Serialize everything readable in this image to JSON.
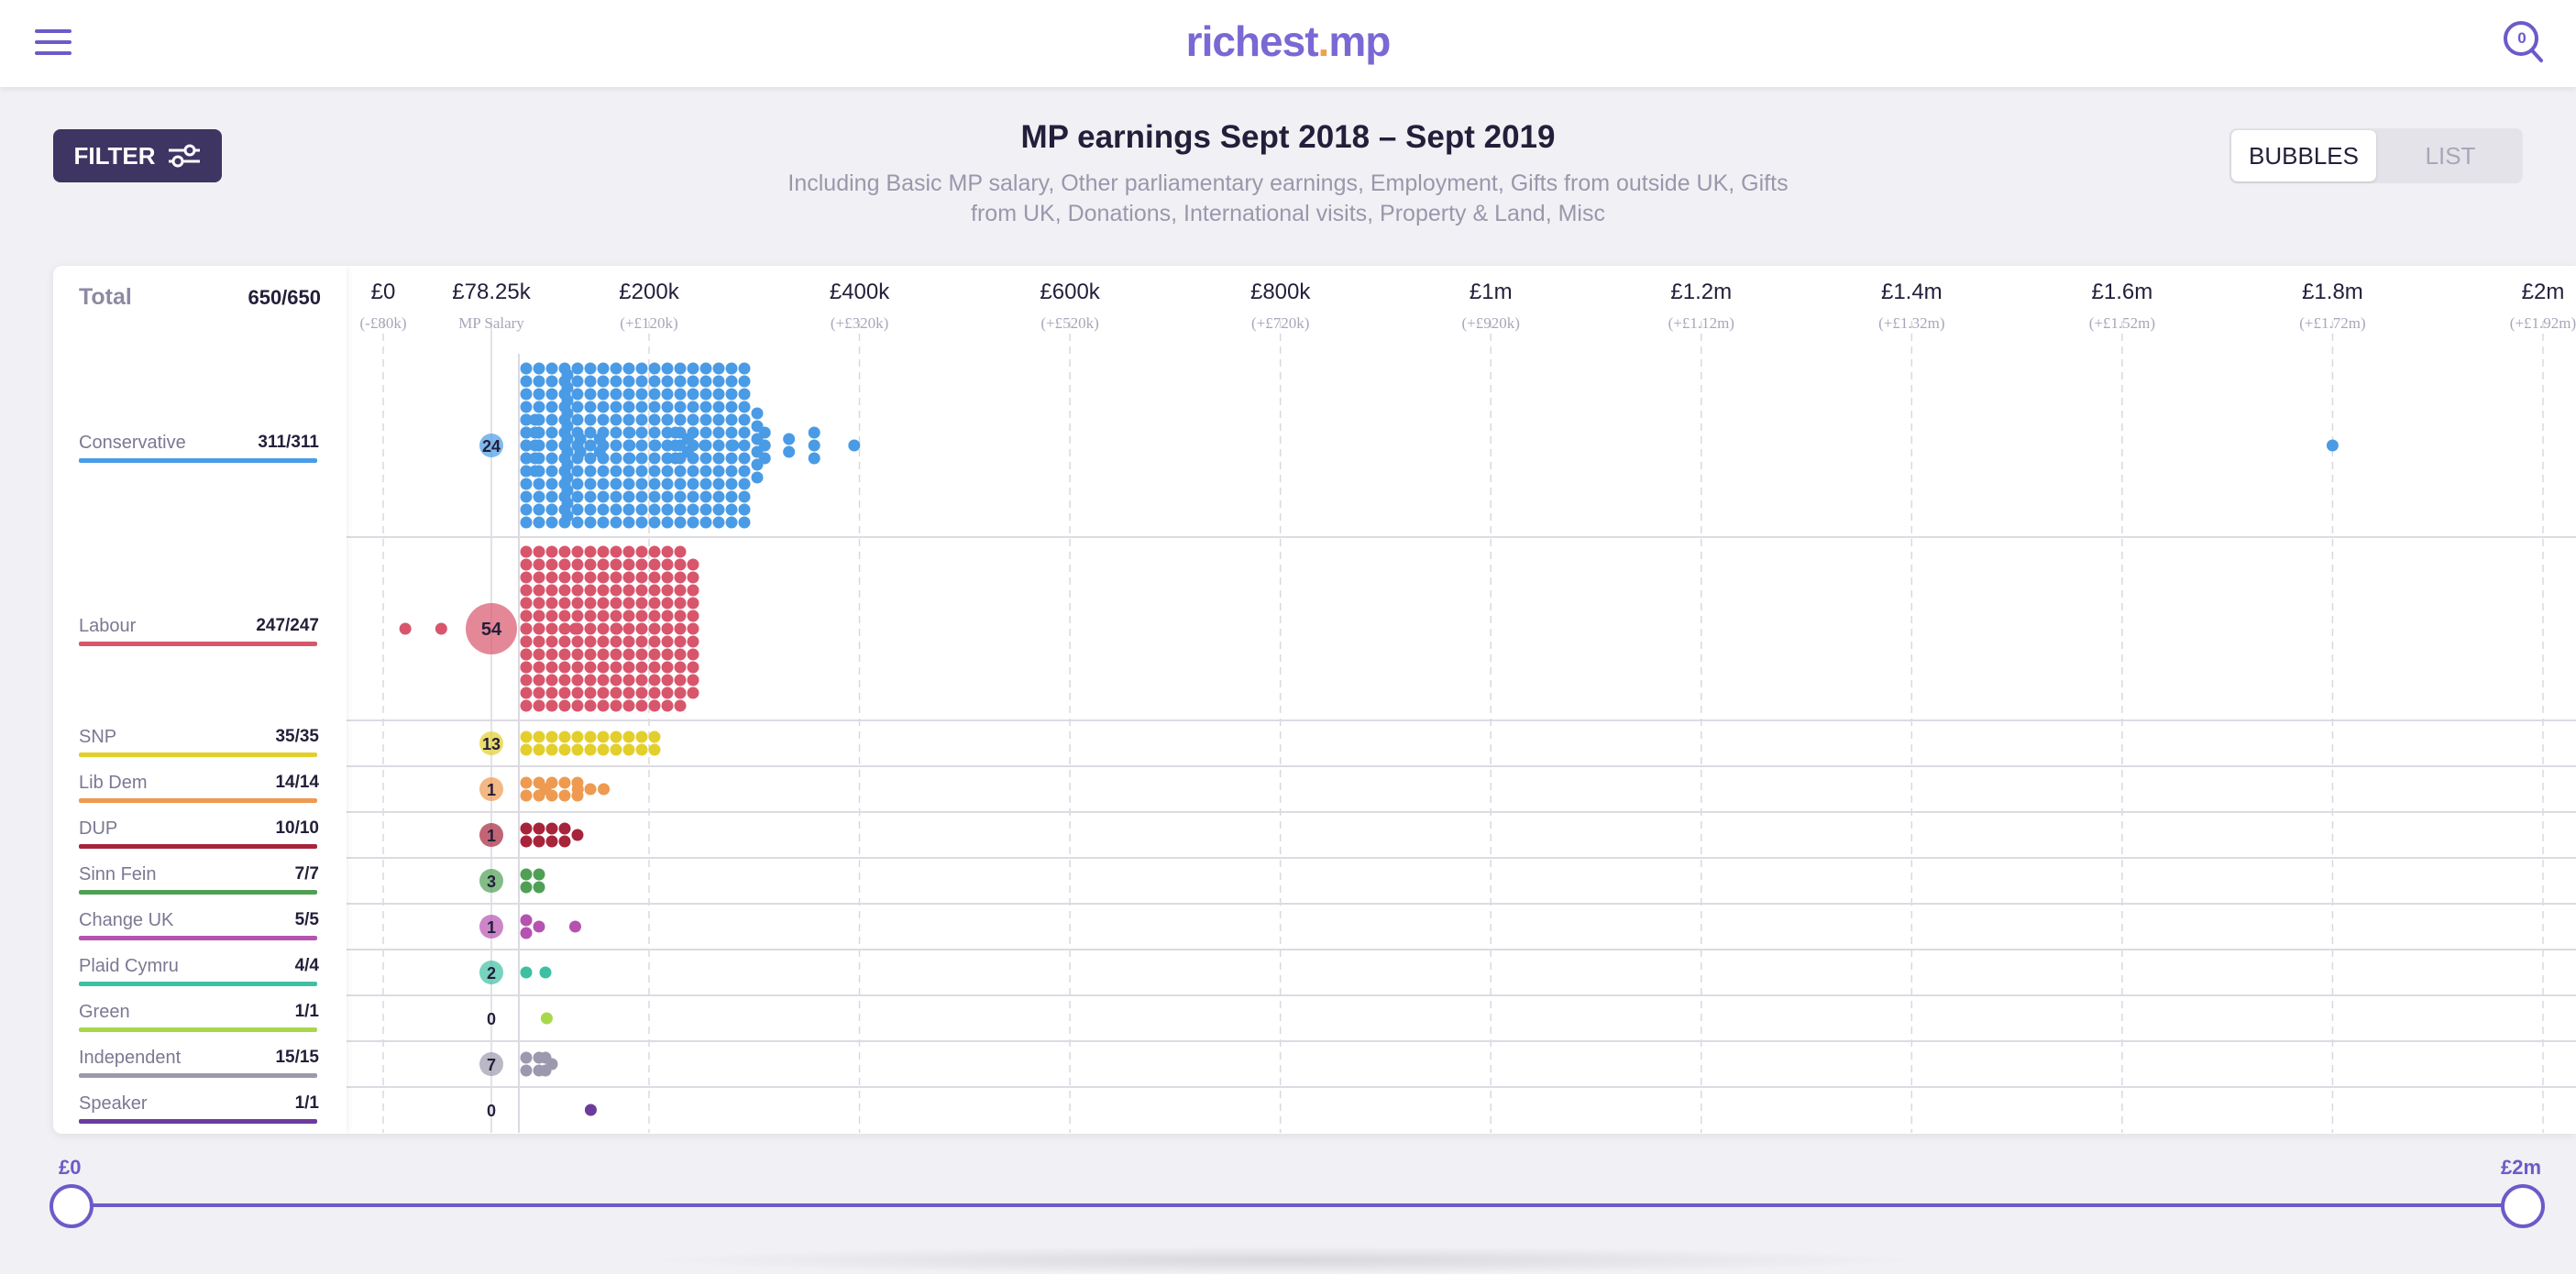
{
  "header": {
    "logo_main": "richest",
    "logo_dot": ".",
    "logo_tld": "mp",
    "search_count": "0"
  },
  "filter": {
    "label": "FILTER"
  },
  "view_toggle": {
    "bubbles": "BUBBLES",
    "list": "LIST",
    "active": "BUBBLES"
  },
  "chart_data": {
    "type": "scatter",
    "title": "MP earnings Sept 2018 – Sept 2019",
    "subtitle": "Including Basic MP salary, Other parliamentary earnings, Employment, Gifts from outside UK, Gifts from UK, Donations, International visits, Property & Land, Misc",
    "total_label": "Total",
    "total_count": "650/650",
    "x_unit": "GBP",
    "x_ticks": [
      {
        "value": 0,
        "main": "£0",
        "sub": "(-£80k)"
      },
      {
        "value": 78250,
        "main": "£78.25k",
        "sub": "MP Salary"
      },
      {
        "value": 200000,
        "main": "£200k",
        "sub": "(+£120k)"
      },
      {
        "value": 400000,
        "main": "£400k",
        "sub": "(+£320k)"
      },
      {
        "value": 600000,
        "main": "£600k",
        "sub": "(+£520k)"
      },
      {
        "value": 800000,
        "main": "£800k",
        "sub": "(+£720k)"
      },
      {
        "value": 1000000,
        "main": "£1m",
        "sub": "(+£920k)"
      },
      {
        "value": 1200000,
        "main": "£1.2m",
        "sub": "(+£1.12m)"
      },
      {
        "value": 1400000,
        "main": "£1.4m",
        "sub": "(+£1.32m)"
      },
      {
        "value": 1600000,
        "main": "£1.6m",
        "sub": "(+£1.52m)"
      },
      {
        "value": 1800000,
        "main": "£1.8m",
        "sub": "(+£1.72m)"
      },
      {
        "value": 2000000,
        "main": "£2m",
        "sub": "(+£1.92m)"
      }
    ],
    "series": [
      {
        "name": "Conservative",
        "count": "311/311",
        "color": "#4a9be6",
        "at_salary": 24,
        "bins": [
          [
            80000,
            240
          ],
          [
            95000,
            5
          ],
          [
            112000,
            5
          ],
          [
            137000,
            12
          ],
          [
            147000,
            2
          ],
          [
            162000,
            2
          ],
          [
            185000,
            3
          ],
          [
            206000,
            1
          ],
          [
            225000,
            3
          ],
          [
            237000,
            2
          ],
          [
            253000,
            1
          ],
          [
            280000,
            1
          ],
          [
            310000,
            3
          ],
          [
            333000,
            2
          ],
          [
            357000,
            3
          ],
          [
            395000,
            1
          ],
          [
            1800000,
            1
          ]
        ]
      },
      {
        "name": "Labour",
        "count": "247/247",
        "color": "#d8566b",
        "at_salary": 54,
        "bins": [
          [
            16000,
            1
          ],
          [
            42000,
            1
          ],
          [
            80000,
            180
          ],
          [
            95000,
            7
          ],
          [
            143000,
            1
          ],
          [
            175000,
            1
          ]
        ]
      },
      {
        "name": "SNP",
        "count": "35/35",
        "color": "#e3cf2c",
        "at_salary": 13,
        "bins": [
          [
            80000,
            22
          ]
        ]
      },
      {
        "name": "Lib Dem",
        "count": "14/14",
        "color": "#ee9a50",
        "at_salary": 1,
        "bins": [
          [
            80000,
            11
          ],
          [
            120000,
            1
          ],
          [
            145000,
            1
          ],
          [
            165000,
            1
          ]
        ]
      },
      {
        "name": "DUP",
        "count": "10/10",
        "color": "#a7243a",
        "at_salary": 1,
        "bins": [
          [
            80000,
            9
          ]
        ]
      },
      {
        "name": "Sinn Fein",
        "count": "7/7",
        "color": "#4fa054",
        "at_salary": 3,
        "bins": [
          [
            80000,
            4
          ]
        ]
      },
      {
        "name": "Change UK",
        "count": "5/5",
        "color": "#b652b0",
        "at_salary": 1,
        "bins": [
          [
            82000,
            3
          ],
          [
            143000,
            1
          ]
        ]
      },
      {
        "name": "Plaid Cymru",
        "count": "4/4",
        "color": "#3cc0a1",
        "at_salary": 2,
        "bins": [
          [
            84000,
            1
          ],
          [
            120000,
            1
          ]
        ]
      },
      {
        "name": "Green",
        "count": "1/1",
        "color": "#a8d84a",
        "at_salary": 0,
        "bins": [
          [
            121000,
            1
          ]
        ]
      },
      {
        "name": "Independent",
        "count": "15/15",
        "color": "#9c98ae",
        "at_salary": 7,
        "bins": [
          [
            84000,
            5
          ],
          [
            120000,
            3
          ]
        ]
      },
      {
        "name": "Speaker",
        "count": "1/1",
        "color": "#6c3c9c",
        "at_salary": 0,
        "bins": [
          [
            155000,
            1
          ]
        ]
      }
    ]
  },
  "range": {
    "min_label": "£0",
    "max_label": "£2m",
    "min_value": 0,
    "max_value": 2000000
  }
}
